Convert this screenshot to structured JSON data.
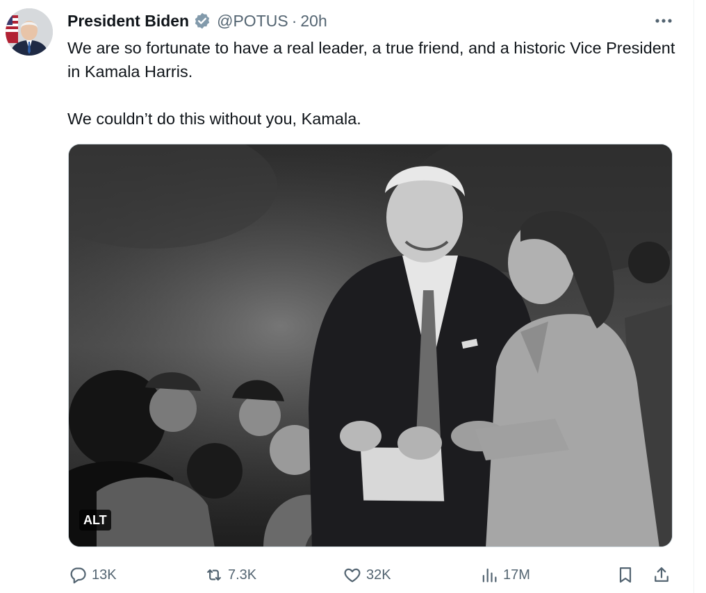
{
  "tweet": {
    "author_name": "President Biden",
    "verified_icon": "verified-badge-icon",
    "handle": "@POTUS",
    "separator": "·",
    "time": "20h",
    "more_icon": "more-icon",
    "paragraphs": [
      "We are so fortunate to have a real leader, a true friend, and a historic Vice President in Kamala Harris.",
      "We couldn’t do this without you, Kamala."
    ],
    "media": {
      "alt_badge": "ALT"
    }
  },
  "actions": {
    "replies": "13K",
    "reposts": "7.3K",
    "likes": "32K",
    "views": "17M"
  },
  "colors": {
    "text": "#0f1419",
    "secondary": "#536471",
    "verified": "#829aab",
    "border": "#cfd9de"
  },
  "icons": [
    "reply-icon",
    "repost-icon",
    "like-icon",
    "views-icon",
    "bookmark-icon",
    "share-icon"
  ]
}
